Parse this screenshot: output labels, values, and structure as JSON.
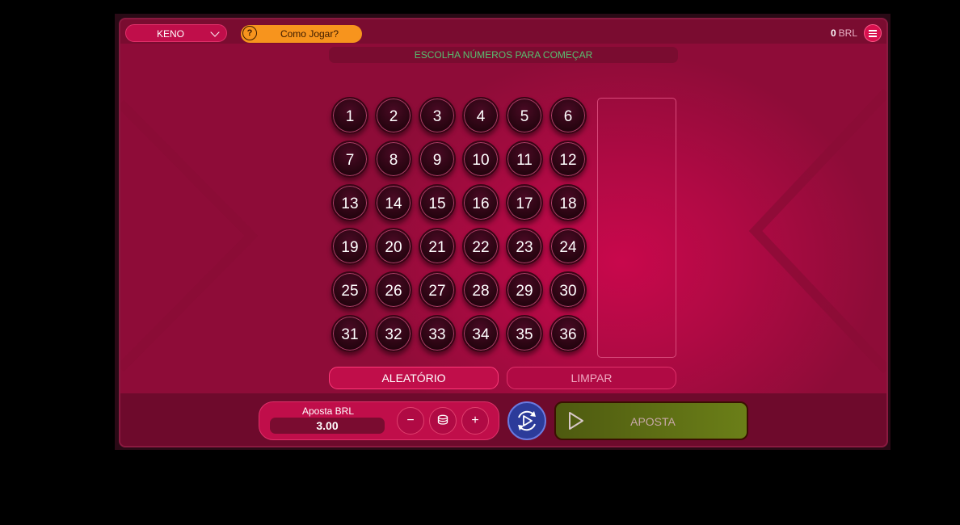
{
  "header": {
    "game_select": "KENO",
    "how_to_play": "Como Jogar?",
    "help_glyph": "?",
    "balance_value": "0",
    "balance_currency": "BRL"
  },
  "status_message": "ESCOLHA NÚMEROS PARA COMEÇAR",
  "board": {
    "numbers": [
      "1",
      "2",
      "3",
      "4",
      "5",
      "6",
      "7",
      "8",
      "9",
      "10",
      "11",
      "12",
      "13",
      "14",
      "15",
      "16",
      "17",
      "18",
      "19",
      "20",
      "21",
      "22",
      "23",
      "24",
      "25",
      "26",
      "27",
      "28",
      "29",
      "30",
      "31",
      "32",
      "33",
      "34",
      "35",
      "36"
    ]
  },
  "actions": {
    "random_label": "ALEATÓRIO",
    "clear_label": "LIMPAR"
  },
  "bet": {
    "title": "Aposta BRL",
    "amount": "3.00",
    "minus": "−",
    "plus": "+"
  },
  "place_bet_label": "APOSTA",
  "colors": {
    "background": "#b00a44",
    "accent_orange": "#f7941d",
    "status_green": "#58c070",
    "autoplay_blue": "#2c3b9a",
    "bet_button": "#5a6a14"
  }
}
